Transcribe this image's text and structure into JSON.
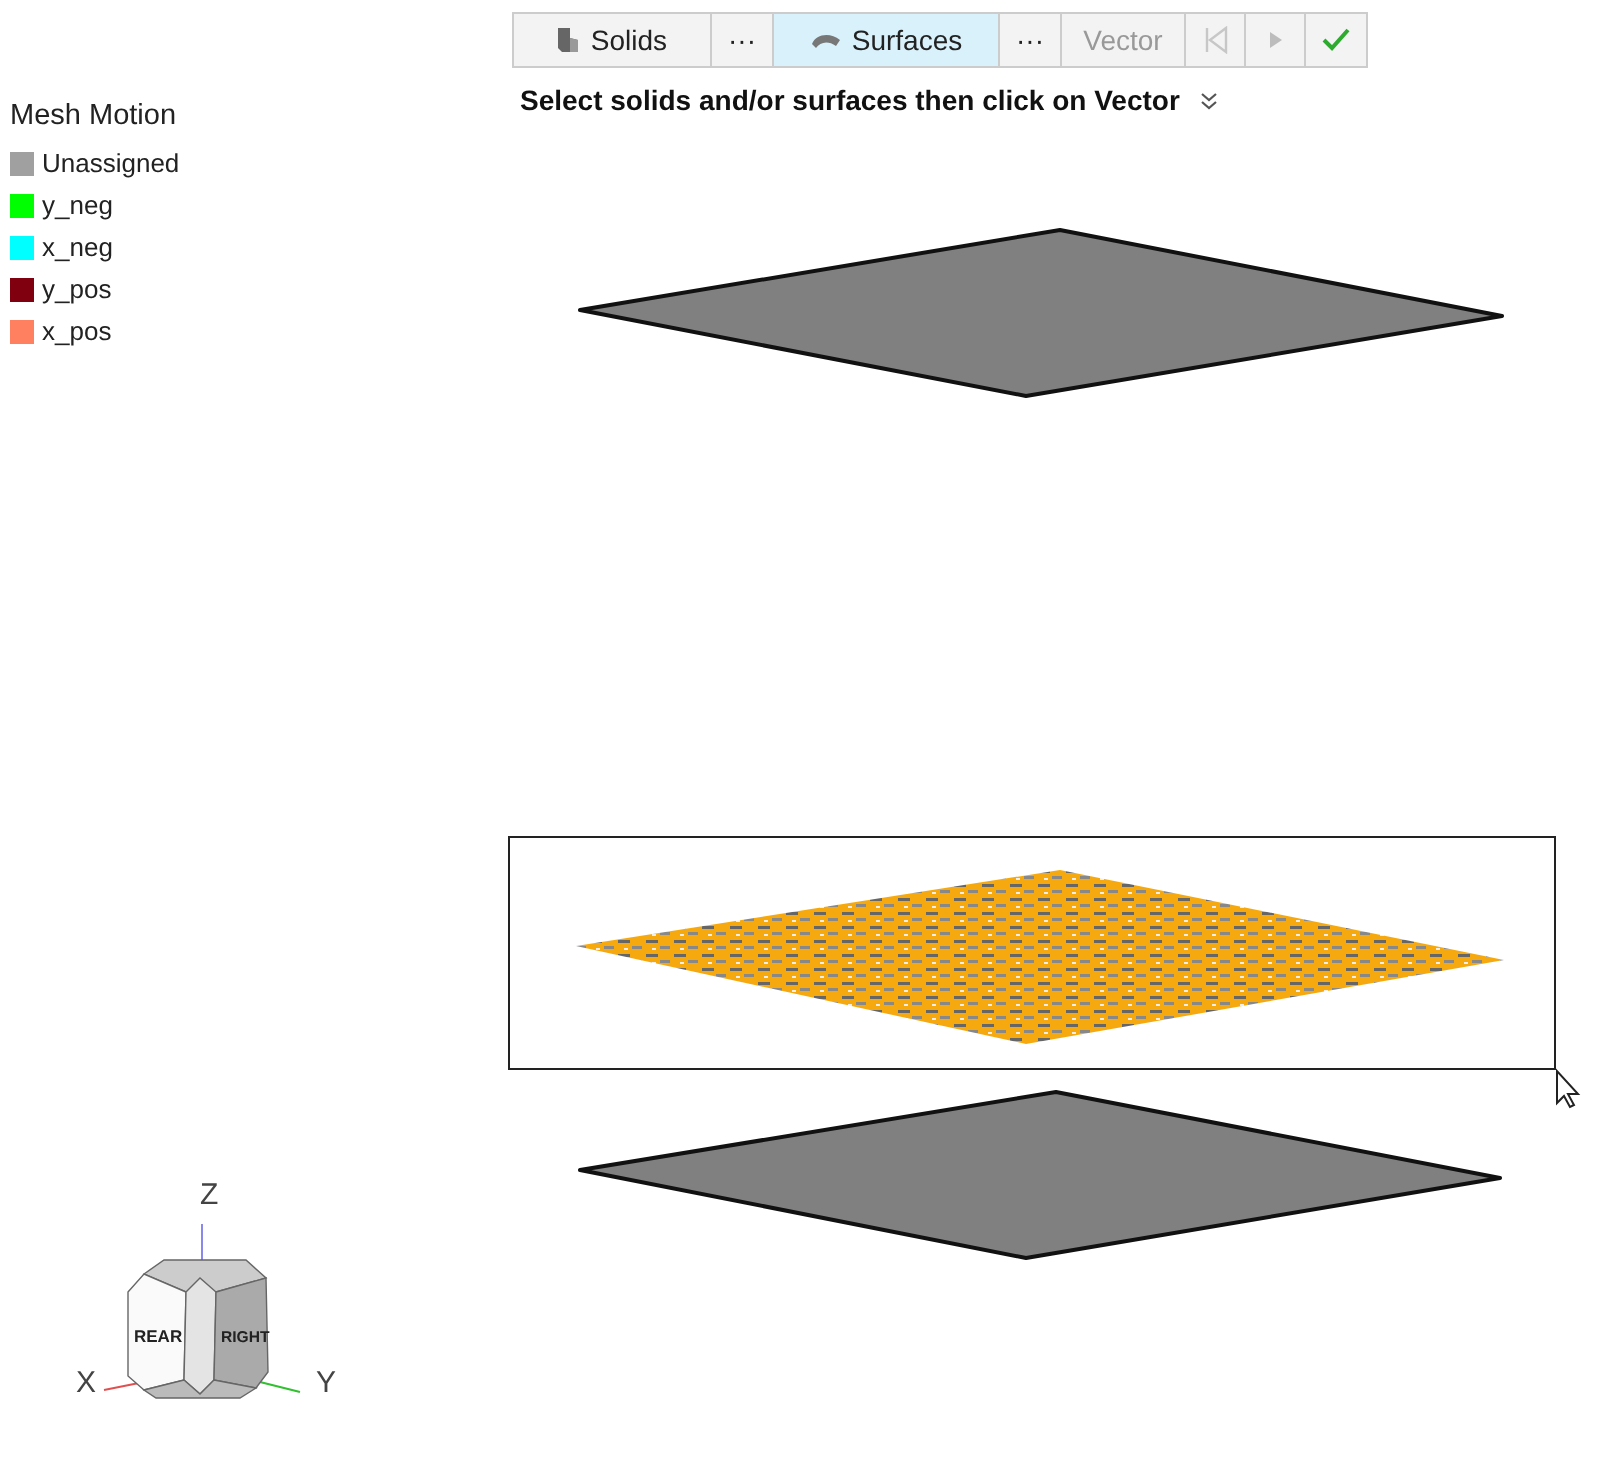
{
  "toolbar": [
    {
      "kind": "solids",
      "label": "Solids",
      "selected": false,
      "disabled": false
    },
    {
      "kind": "more",
      "label": "···",
      "selected": false,
      "disabled": false
    },
    {
      "kind": "surfaces",
      "label": "Surfaces",
      "selected": true,
      "disabled": false
    },
    {
      "kind": "more",
      "label": "···",
      "selected": false,
      "disabled": false
    },
    {
      "kind": "text",
      "label": "Vector",
      "selected": false,
      "disabled": true
    },
    {
      "kind": "first",
      "selected": false,
      "disabled": true
    },
    {
      "kind": "play",
      "selected": false,
      "disabled": true
    },
    {
      "kind": "confirm",
      "selected": false,
      "disabled": false
    }
  ],
  "prompt": "Select solids and/or surfaces then click on Vector",
  "legend": {
    "title": "Mesh Motion",
    "items": [
      {
        "label": "Unassigned",
        "color": "#a0a0a0"
      },
      {
        "label": "y_neg",
        "color": "#00ff00"
      },
      {
        "label": "x_neg",
        "color": "#00ffff"
      },
      {
        "label": "y_pos",
        "color": "#800010"
      },
      {
        "label": "x_pos",
        "color": "#ff8060"
      }
    ]
  },
  "view_cube": {
    "axes": {
      "z": "Z",
      "x": "X",
      "y": "Y"
    },
    "faces": {
      "left": "REAR",
      "right": "RIGHT"
    }
  }
}
